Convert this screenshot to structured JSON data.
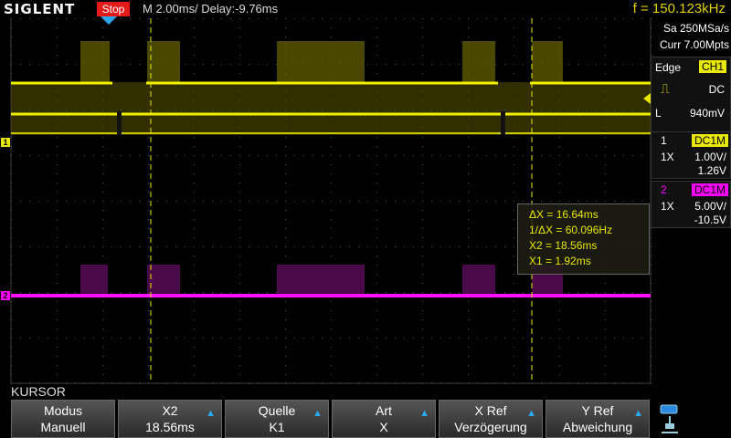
{
  "header": {
    "logo": "SIGLENT",
    "status": "Stop",
    "timebase": "M 2.00ms/ Delay:-9.76ms",
    "frequency": "f = 150.123kHz"
  },
  "acquisition": {
    "sample_rate": "Sa 250MSa/s",
    "memory": "Curr 7.00Mpts"
  },
  "trigger": {
    "type_label": "Edge",
    "source": "CH1",
    "coupling": "DC",
    "level_prefix": "L",
    "level": "940mV"
  },
  "channels": [
    {
      "num": "1",
      "coupling": "DC1M",
      "probe": "1X",
      "scale": "1.00V/",
      "offset": "1.26V",
      "color": "#e8e800"
    },
    {
      "num": "2",
      "coupling": "DC1M",
      "probe": "1X",
      "scale": "5.00V/",
      "offset": "-10.5V",
      "color": "#ff00ff"
    }
  ],
  "cursor": {
    "dx": "ΔX = 16.64ms",
    "inv_dx": "1/ΔX = 60.096Hz",
    "x2": "X2 = 18.56ms",
    "x1": "X1 = 1.92ms"
  },
  "menu": {
    "title": "KURSOR",
    "softkeys": [
      {
        "l1": "Modus",
        "l2": "Manuell",
        "arrow": false
      },
      {
        "l1": "X2",
        "l2": "18.56ms",
        "arrow": true
      },
      {
        "l1": "Quelle",
        "l2": "K1",
        "arrow": true
      },
      {
        "l1": "Art",
        "l2": "X",
        "arrow": true
      },
      {
        "l1": "X Ref",
        "l2": "Verzögerung",
        "arrow": true
      },
      {
        "l1": "Y Ref",
        "l2": "Abweichung",
        "arrow": true
      }
    ]
  },
  "markers": {
    "ch1": "1",
    "ch2": "2"
  }
}
